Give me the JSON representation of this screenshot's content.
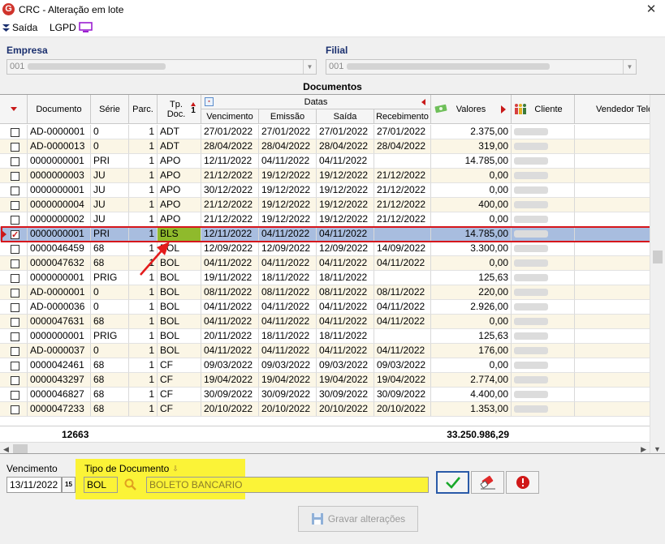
{
  "window": {
    "title": "CRC - Alteração em lote",
    "logo_letter": "G",
    "close_symbol": "✕"
  },
  "toolbar": {
    "exit_label": "Saída",
    "lgpd_label": "LGPD"
  },
  "filters": {
    "empresa_label": "Empresa",
    "empresa_code": "001",
    "filial_label": "Filial",
    "filial_code": "001"
  },
  "grid": {
    "title": "Documentos",
    "headers": {
      "documento": "Documento",
      "serie": "Série",
      "parc": "Parc.",
      "tp_doc": "Tp. Doc.",
      "sort_number": "1",
      "datas": "Datas",
      "vencimento": "Vencimento",
      "emissao": "Emissão",
      "saida": "Saída",
      "recebimento": "Recebimento",
      "valores": "Valores",
      "cliente": "Cliente",
      "vendedor": "Vendedor Tele"
    },
    "rows": [
      {
        "checked": false,
        "documento": "AD-0000001",
        "serie": "0",
        "parc": "1",
        "tp": "ADT",
        "venc": "27/01/2022",
        "emis": "27/01/2022",
        "saida": "27/01/2022",
        "receb": "27/01/2022",
        "valor": "2.375,00"
      },
      {
        "checked": false,
        "documento": "AD-0000013",
        "serie": "0",
        "parc": "1",
        "tp": "ADT",
        "venc": "28/04/2022",
        "emis": "28/04/2022",
        "saida": "28/04/2022",
        "receb": "28/04/2022",
        "valor": "319,00"
      },
      {
        "checked": false,
        "documento": "0000000001",
        "serie": "PRI",
        "parc": "1",
        "tp": "APO",
        "venc": "12/11/2022",
        "emis": "04/11/2022",
        "saida": "04/11/2022",
        "receb": "",
        "valor": "14.785,00"
      },
      {
        "checked": false,
        "documento": "0000000003",
        "serie": "JU",
        "parc": "1",
        "tp": "APO",
        "venc": "21/12/2022",
        "emis": "19/12/2022",
        "saida": "19/12/2022",
        "receb": "21/12/2022",
        "valor": "0,00"
      },
      {
        "checked": false,
        "documento": "0000000001",
        "serie": "JU",
        "parc": "1",
        "tp": "APO",
        "venc": "30/12/2022",
        "emis": "19/12/2022",
        "saida": "19/12/2022",
        "receb": "21/12/2022",
        "valor": "0,00"
      },
      {
        "checked": false,
        "documento": "0000000004",
        "serie": "JU",
        "parc": "1",
        "tp": "APO",
        "venc": "21/12/2022",
        "emis": "19/12/2022",
        "saida": "19/12/2022",
        "receb": "21/12/2022",
        "valor": "400,00"
      },
      {
        "checked": false,
        "documento": "0000000002",
        "serie": "JU",
        "parc": "1",
        "tp": "APO",
        "venc": "21/12/2022",
        "emis": "19/12/2022",
        "saida": "19/12/2022",
        "receb": "21/12/2022",
        "valor": "0,00"
      },
      {
        "checked": true,
        "selected": true,
        "documento": "0000000001",
        "serie": "PRI",
        "parc": "1",
        "tp": "BLS",
        "venc": "12/11/2022",
        "emis": "04/11/2022",
        "saida": "04/11/2022",
        "receb": "",
        "valor": "14.785,00"
      },
      {
        "checked": false,
        "documento": "0000046459",
        "serie": "68",
        "parc": "1",
        "tp": "BOL",
        "venc": "12/09/2022",
        "emis": "12/09/2022",
        "saida": "12/09/2022",
        "receb": "14/09/2022",
        "valor": "3.300,00"
      },
      {
        "checked": false,
        "documento": "0000047632",
        "serie": "68",
        "parc": "1",
        "tp": "BOL",
        "venc": "04/11/2022",
        "emis": "04/11/2022",
        "saida": "04/11/2022",
        "receb": "04/11/2022",
        "valor": "0,00"
      },
      {
        "checked": false,
        "documento": "0000000001",
        "serie": "PRIG",
        "parc": "1",
        "tp": "BOL",
        "venc": "19/11/2022",
        "emis": "18/11/2022",
        "saida": "18/11/2022",
        "receb": "",
        "valor": "125,63"
      },
      {
        "checked": false,
        "documento": "AD-0000001",
        "serie": "0",
        "parc": "1",
        "tp": "BOL",
        "venc": "08/11/2022",
        "emis": "08/11/2022",
        "saida": "08/11/2022",
        "receb": "08/11/2022",
        "valor": "220,00"
      },
      {
        "checked": false,
        "documento": "AD-0000036",
        "serie": "0",
        "parc": "1",
        "tp": "BOL",
        "venc": "04/11/2022",
        "emis": "04/11/2022",
        "saida": "04/11/2022",
        "receb": "04/11/2022",
        "valor": "2.926,00"
      },
      {
        "checked": false,
        "documento": "0000047631",
        "serie": "68",
        "parc": "1",
        "tp": "BOL",
        "venc": "04/11/2022",
        "emis": "04/11/2022",
        "saida": "04/11/2022",
        "receb": "04/11/2022",
        "valor": "0,00"
      },
      {
        "checked": false,
        "documento": "0000000001",
        "serie": "PRIG",
        "parc": "1",
        "tp": "BOL",
        "venc": "20/11/2022",
        "emis": "18/11/2022",
        "saida": "18/11/2022",
        "receb": "",
        "valor": "125,63"
      },
      {
        "checked": false,
        "documento": "AD-0000037",
        "serie": "0",
        "parc": "1",
        "tp": "BOL",
        "venc": "04/11/2022",
        "emis": "04/11/2022",
        "saida": "04/11/2022",
        "receb": "04/11/2022",
        "valor": "176,00"
      },
      {
        "checked": false,
        "documento": "0000042461",
        "serie": "68",
        "parc": "1",
        "tp": "CF",
        "venc": "09/03/2022",
        "emis": "09/03/2022",
        "saida": "09/03/2022",
        "receb": "09/03/2022",
        "valor": "0,00"
      },
      {
        "checked": false,
        "documento": "0000043297",
        "serie": "68",
        "parc": "1",
        "tp": "CF",
        "venc": "19/04/2022",
        "emis": "19/04/2022",
        "saida": "19/04/2022",
        "receb": "19/04/2022",
        "valor": "2.774,00"
      },
      {
        "checked": false,
        "documento": "0000046827",
        "serie": "68",
        "parc": "1",
        "tp": "CF",
        "venc": "30/09/2022",
        "emis": "30/09/2022",
        "saida": "30/09/2022",
        "receb": "30/09/2022",
        "valor": "4.400,00"
      },
      {
        "checked": false,
        "documento": "0000047233",
        "serie": "68",
        "parc": "1",
        "tp": "CF",
        "venc": "20/10/2022",
        "emis": "20/10/2022",
        "saida": "20/10/2022",
        "receb": "20/10/2022",
        "valor": "1.353,00"
      }
    ],
    "footer": {
      "count": "12663",
      "total": "33.250.986,29"
    }
  },
  "form": {
    "vencimento_label": "Vencimento",
    "vencimento_value": "13/11/2022",
    "calendar_day": "15",
    "tipo_label": "Tipo de Documento",
    "tipo_code": "BOL",
    "tipo_desc": "BOLETO BANCARIO",
    "save_label": "Gravar alterações",
    "colors": {
      "highlight": "#fbf337",
      "selection_border": "#d6161c",
      "selected_row": "#a8bddf",
      "selected_tp": "#8fba2c",
      "alt_row": "#fbf6e6"
    }
  }
}
